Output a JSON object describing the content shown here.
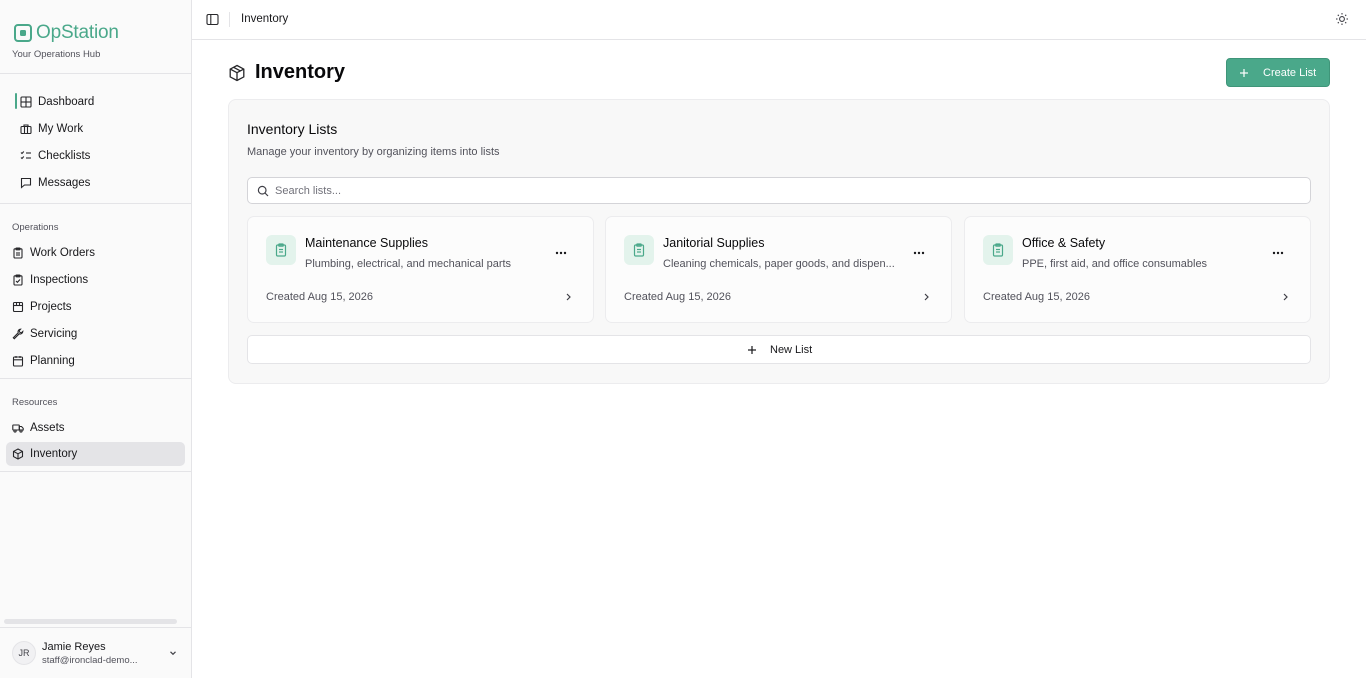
{
  "brand": {
    "name": "OpStation",
    "tagline": "Your Operations Hub"
  },
  "colors": {
    "accent": "#4aa88a",
    "accent_soft": "#e3f3ec",
    "active_nav_bg": "#e4e4e7"
  },
  "sidebar": {
    "top_items": [
      {
        "label": "Dashboard",
        "icon": "dashboard-icon",
        "indicator": true
      },
      {
        "label": "My Work",
        "icon": "briefcase-icon"
      },
      {
        "label": "Checklists",
        "icon": "checklist-icon"
      },
      {
        "label": "Messages",
        "icon": "message-icon"
      }
    ],
    "groups": [
      {
        "label": "Operations",
        "items": [
          {
            "label": "Work Orders",
            "icon": "clipboard-icon"
          },
          {
            "label": "Inspections",
            "icon": "clipboard-check-icon"
          },
          {
            "label": "Projects",
            "icon": "folder-icon"
          },
          {
            "label": "Servicing",
            "icon": "wrench-icon"
          },
          {
            "label": "Planning",
            "icon": "calendar-icon"
          }
        ]
      },
      {
        "label": "Resources",
        "items": [
          {
            "label": "Assets",
            "icon": "truck-icon"
          },
          {
            "label": "Inventory",
            "icon": "package-icon",
            "active": true
          }
        ]
      }
    ],
    "user": {
      "initials": "JR",
      "name": "Jamie Reyes",
      "email": "staff@ironclad-demo..."
    }
  },
  "topbar": {
    "breadcrumb": "Inventory",
    "toggle_icon": "sidebar-toggle-icon",
    "theme_icon": "sun-icon"
  },
  "page": {
    "title": "Inventory",
    "icon": "package-icon",
    "create_button": "Create List"
  },
  "inventory": {
    "title": "Inventory Lists",
    "subtitle": "Manage your inventory by organizing items into lists",
    "search_placeholder": "Search lists...",
    "search_value": "",
    "lists": [
      {
        "name": "Maintenance Supplies",
        "description": "Plumbing, electrical, and mechanical parts",
        "created": "Created Aug 15, 2026"
      },
      {
        "name": "Janitorial Supplies",
        "description": "Cleaning chemicals, paper goods, and dispen...",
        "created": "Created Aug 15, 2026"
      },
      {
        "name": "Office & Safety",
        "description": "PPE, first aid, and office consumables",
        "created": "Created Aug 15, 2026"
      }
    ],
    "new_list_label": "New List"
  }
}
